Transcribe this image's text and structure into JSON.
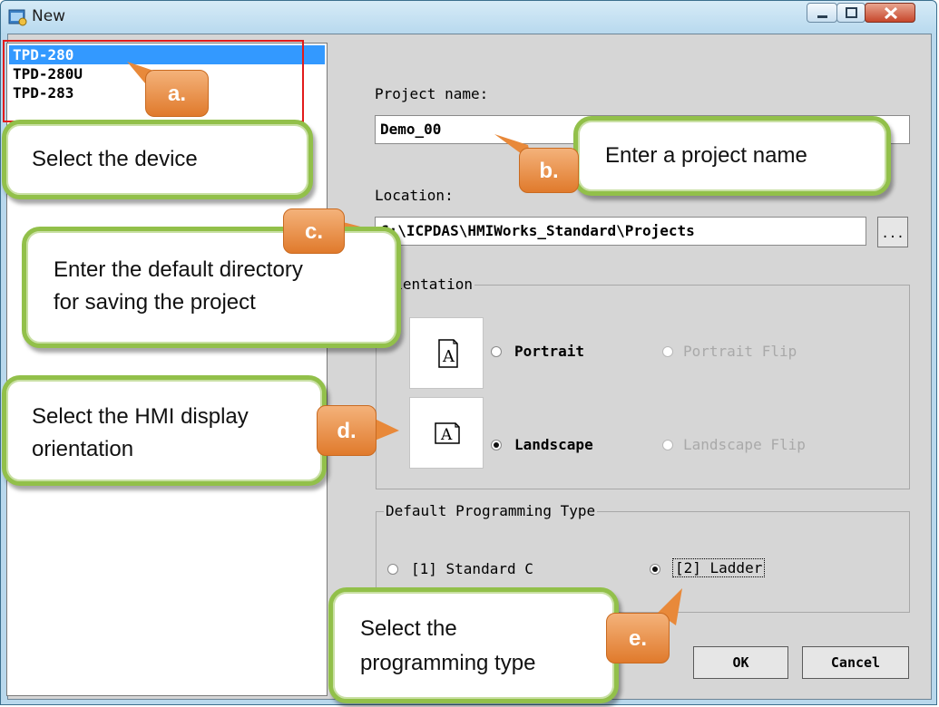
{
  "window": {
    "title": "New"
  },
  "device_list": {
    "items": [
      {
        "label": "TPD-280",
        "selected": true
      },
      {
        "label": "TPD-280U",
        "selected": false
      },
      {
        "label": "TPD-283",
        "selected": false
      }
    ]
  },
  "project": {
    "name_label": "Project name:",
    "name_value": "Demo_00",
    "location_label": "Location:",
    "location_value": "C:\\ICPDAS\\HMIWorks_Standard\\Projects",
    "browse_label": "..."
  },
  "orientation": {
    "group_label": "Orientation",
    "options": [
      {
        "label": "Portrait",
        "selected": false,
        "enabled": true
      },
      {
        "label": "Portrait Flip",
        "selected": false,
        "enabled": false
      },
      {
        "label": "Landscape",
        "selected": true,
        "enabled": true
      },
      {
        "label": "Landscape Flip",
        "selected": false,
        "enabled": false
      }
    ]
  },
  "programming": {
    "group_label": "Default Programming Type",
    "options": [
      {
        "label": "[1] Standard C",
        "selected": false
      },
      {
        "label": "[2] Ladder",
        "selected": true
      }
    ]
  },
  "buttons": {
    "ok": "OK",
    "cancel": "Cancel"
  },
  "callouts": {
    "a": {
      "badge": "a.",
      "text": "Select the device"
    },
    "b": {
      "badge": "b.",
      "text": "Enter a project name"
    },
    "c": {
      "badge": "c.",
      "line1": "Enter the default directory",
      "line2": "for saving the project"
    },
    "d": {
      "badge": "d.",
      "line1": "Select the HMI display",
      "line2": "orientation"
    },
    "e": {
      "badge": "e.",
      "line1": "Select the",
      "line2": "programming type"
    }
  },
  "colors": {
    "callout_border": "#92c04a",
    "badge": "#e07a2c",
    "selection": "#3399ff",
    "highlight_box": "#e21b1b"
  }
}
